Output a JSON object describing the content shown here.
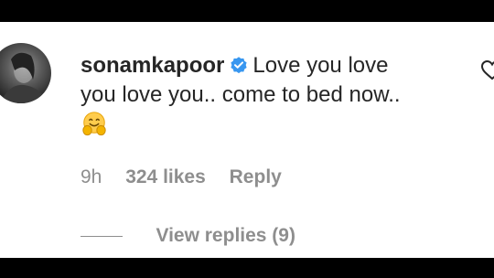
{
  "comment": {
    "username": "sonamkapoor",
    "text_line1": "Love you love",
    "text_line2": "you love you.. come to bed now..",
    "verified_icon": "verified-badge-icon",
    "emoji_icon": "smiling-face-with-open-hands-icon"
  },
  "meta": {
    "time": "9h",
    "likes": "324 likes",
    "reply": "Reply"
  },
  "replies": {
    "label": "View replies (9)"
  },
  "colors": {
    "text": "#262626",
    "secondary": "#8e8e8e",
    "verified_blue": "#3897f0",
    "background": "#ffffff"
  }
}
